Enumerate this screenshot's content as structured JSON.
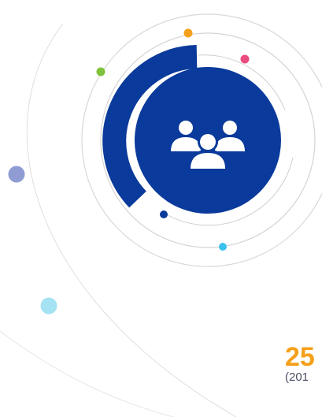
{
  "stat": {
    "value": "25",
    "caption": "(201"
  },
  "icon": "users-group-icon",
  "colors": {
    "primary": "#0a3a9b",
    "accent": "#f5a01a",
    "green": "#7fc23b",
    "pink": "#ec4d80",
    "cyan": "#3cc0ee",
    "lavender": "#8e9cd3",
    "light_cyan": "#a5e2f3",
    "ring": "#d8d8d8"
  }
}
